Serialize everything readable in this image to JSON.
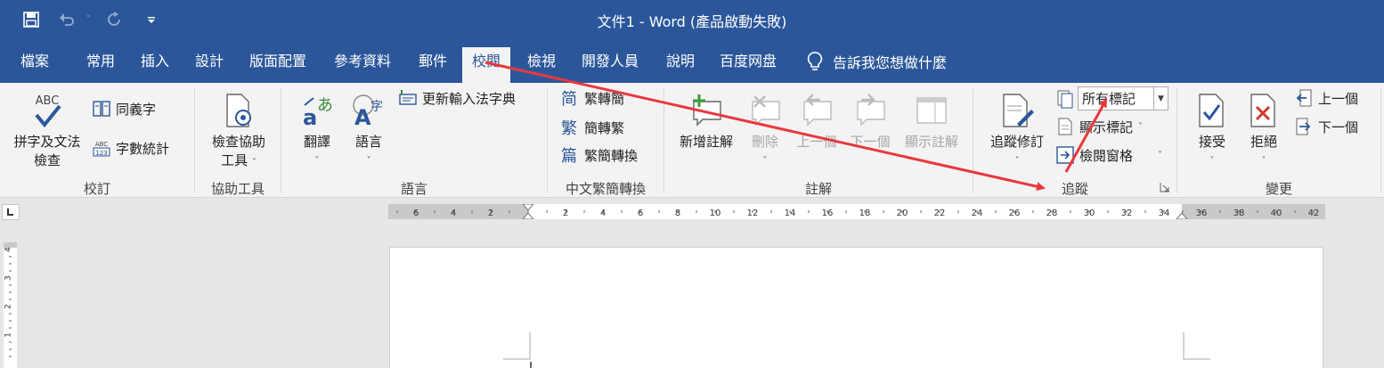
{
  "window": {
    "title": "文件1  -  Word (產品啟動失敗)"
  },
  "qat": {
    "icons": [
      "save-icon",
      "undo-icon",
      "redo-icon",
      "customize-qat-icon"
    ]
  },
  "tabs": [
    {
      "label": "檔案"
    },
    {
      "label": "常用"
    },
    {
      "label": "插入"
    },
    {
      "label": "設計"
    },
    {
      "label": "版面配置"
    },
    {
      "label": "參考資料"
    },
    {
      "label": "郵件"
    },
    {
      "label": "校閱"
    },
    {
      "label": "檢視"
    },
    {
      "label": "開發人員"
    },
    {
      "label": "說明"
    },
    {
      "label": "百度网盘"
    }
  ],
  "active_tab": "校閱",
  "tell_me": "告訴我您想做什麼",
  "ribbon": {
    "proofing": {
      "label": "校訂",
      "spelling_line1": "拼字及文法",
      "spelling_line2": "檢查",
      "thesaurus": "同義字",
      "word_count": "字數統計",
      "abc_text": "ABC",
      "abc123_text": "ABC 123"
    },
    "accessibility": {
      "label": "協助工具",
      "check_line1": "檢查協助",
      "check_line2": "工具"
    },
    "language": {
      "label": "語言",
      "translate": "翻譯",
      "language": "語言",
      "ime": "更新輸入法字典"
    },
    "chinese": {
      "label": "中文繁簡轉換",
      "trad_to_simp": "繁轉簡",
      "simp_to_trad": "簡轉繁",
      "convert": "繁簡轉換"
    },
    "comments": {
      "label": "註解",
      "new": "新增註解",
      "delete": "刪除",
      "previous": "上一個",
      "next": "下一個",
      "show": "顯示註解"
    },
    "tracking": {
      "label": "追蹤",
      "track_changes": "追蹤修訂",
      "markup_combo": "所有標記",
      "show_markup": "顯示標記",
      "reviewing_pane": "檢閱窗格"
    },
    "changes": {
      "label": "變更",
      "accept": "接受",
      "reject": "拒絕",
      "previous": "上一個",
      "next": "下一個"
    }
  },
  "ruler": {
    "h_labels": [
      "6",
      "4",
      "2",
      "2",
      "4",
      "6",
      "8",
      "10",
      "12",
      "14",
      "16",
      "18",
      "20",
      "22",
      "24",
      "26",
      "28",
      "30",
      "32",
      "34",
      "36",
      "38",
      "40",
      "42"
    ],
    "v_labels": [
      "4",
      "3",
      "2",
      "1"
    ]
  },
  "colors": {
    "accent": "#2b579a",
    "annotation": "#e8383d"
  }
}
